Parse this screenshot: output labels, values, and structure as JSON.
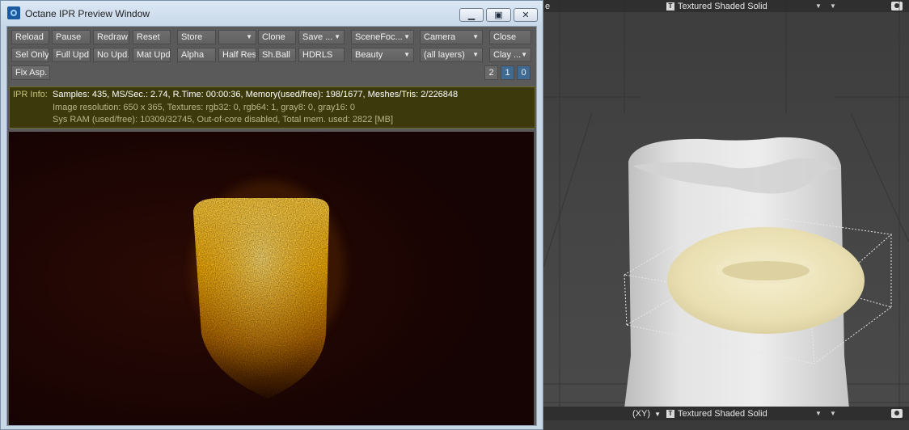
{
  "window": {
    "title": "Octane IPR Preview Window",
    "controls": {
      "minimize": "▁",
      "maximize": "▣",
      "close": "✕"
    }
  },
  "toolbar": {
    "row1": {
      "reload": "Reload",
      "pause": "Pause",
      "redraw": "Redraw",
      "reset": "Reset",
      "store": "Store",
      "store_slot": "",
      "clone": "Clone",
      "save": "Save ...",
      "scene_focus": "SceneFoc...",
      "camera": "Camera",
      "close": "Close"
    },
    "row2": {
      "sel_only": "Sel Only",
      "full_upd": "Full Upd.",
      "no_upd": "No Upd.",
      "mat_upd": "Mat Upd",
      "alpha": "Alpha",
      "half_res": "Half Res",
      "sh_ball": "Sh.Ball",
      "hdrls": "HDRLS",
      "pass": "Beauty",
      "layers": "(all layers)",
      "clay": "Clay ..."
    },
    "row3": {
      "fix_asp": "Fix Asp."
    },
    "counters": [
      "2",
      "1",
      "0"
    ]
  },
  "ipr_info": {
    "label": "IPR Info:",
    "line1": "Samples: 435, MS/Sec.: 2.74, R.Time: 00:00:36, Memory(used/free): 198/1677, Meshes/Tris: 2/226848",
    "line2": "Image resolution: 650 x 365, Textures:  rgb32: 0, rgb64: 1, gray8: 0, gray16: 0",
    "line3": "Sys RAM (used/free): 10309/32745, Out-of-core disabled, Total mem. used: 2822  [MB]"
  },
  "viewport": {
    "top_left_fragment": "e",
    "top_mode": "Textured Shaded Solid",
    "bottom_view": "(XY)",
    "bottom_mode": "Textured Shaded Solid",
    "mode_badge": "T"
  },
  "colors": {
    "render_bg": "#1a0404",
    "glow": "#f0a800",
    "info_bg": "#3c3a0c",
    "active_counter": "#3f6a91"
  }
}
